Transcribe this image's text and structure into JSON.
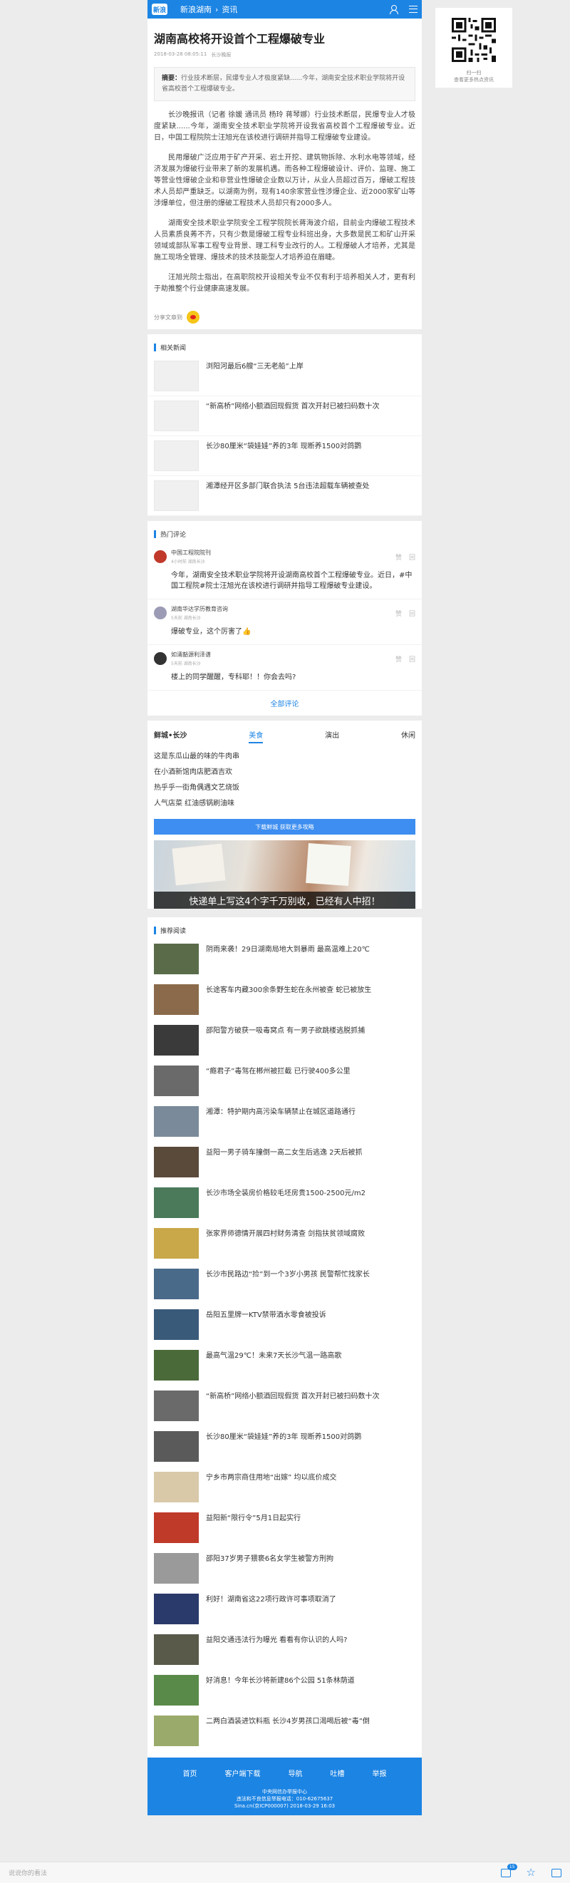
{
  "header": {
    "logo_text": "新浪",
    "breadcrumb": [
      "新浪湖南",
      "›",
      "资讯"
    ]
  },
  "article": {
    "title": "湖南高校将开设首个工程爆破专业",
    "date": "2018-03-28 08:05:11",
    "source": "长沙晚报",
    "summary_label": "摘要：",
    "summary": "行业技术断层，民爆专业人才极度紧缺......今年，湖南安全技术职业学院将开设省高校首个工程爆破专业。",
    "paragraphs": [
      "长沙晚报讯（记者 徐媛 通讯员 杨玲 蒋琴娜）行业技术断层，民爆专业人才极度紧缺......今年，湖南安全技术职业学院将开设我省高校首个工程爆破专业。近日，中国工程院院士汪旭光在该校进行调研并指导工程爆破专业建设。",
      "民用爆破广泛应用于矿产开采、岩土开挖、建筑物拆除、水利水电等领域，经济发展为爆破行业带来了新的发展机遇。而各种工程爆破设计、评价、监理、施工等营业性爆破企业和非营业性爆破企业数以万计，从业人员超过百万，爆破工程技术人员却严重缺乏。以湖南为例，现有140余家营业性涉爆企业、近2000家矿山等涉爆单位，但注册的爆破工程技术人员却只有2000多人。",
      "湖南安全技术职业学院安全工程学院院长蒋海波介绍，目前业内爆破工程技术人员素质良莠不齐，只有少数是爆破工程专业科班出身，大多数是民工和矿山开采领域或部队军事工程专业背景、理工科专业改行的人。工程爆破人才培养，尤其是施工现场全管理、爆技术的技术技能型人才培养迫在眉睫。",
      "汪旭光院士指出，在高职院校开设相关专业不仅有利于培养相关人才，更有利于助推整个行业健康高速发展。"
    ],
    "share_label": "分享文章到"
  },
  "related": {
    "heading": "相关新闻",
    "items": [
      "浏阳河最后6艘“三无老船”上岸",
      "“新高桥”网络小额酒回现假货 首次开封已被扫码数十次",
      "长沙80厘米“袋娃娃”养的3年 现断养1500对鸽鹦",
      "湘潭经开区多部门联合执法 5台违法超载车辆被查处"
    ]
  },
  "comments": {
    "heading": "热门评论",
    "items": [
      {
        "name": "中国工程院院刊",
        "time": "4小时前 湖南长沙",
        "text": "今年，湖南安全技术职业学院将开设湖南高校首个工程爆破专业。近日，#中国工程院#院士汪旭光在该校进行调研并指导工程爆破专业建设。",
        "avatar_color": "#c0392b"
      },
      {
        "name": "湖南华达学历教育咨询",
        "time": "5天前 湖南长沙",
        "text": "爆破专业，这个厉害了👍",
        "avatar_color": "#9b9bb5"
      },
      {
        "name": "如涌豁源利泽谱",
        "time": "5天前 湖南长沙",
        "text": "楼上的同学醒醒，专科耶！！你会去吗?",
        "avatar_color": "#333333"
      }
    ],
    "like_label": "赞",
    "reply_label": "回",
    "all_label": "全部评论"
  },
  "local": {
    "tabs": [
      "鲜城•长沙",
      "美食",
      "演出",
      "休闲"
    ],
    "active_tab": "美食",
    "items": [
      "这是东瓜山最的味的牛肉串",
      "在小酒新馆肉店肥酒吉欢",
      "热乎乎一街角偶遇文艺烧饭",
      "人气店菜 红油感锅刷油味"
    ],
    "download_label": "下载鲜城 获取更多攻略",
    "ad_caption": "快递单上写这4个字千万别收，已经有人中招！"
  },
  "recommend": {
    "heading": "推荐阅读",
    "items": [
      {
        "title": "阴雨来袭！29日湖南局地大到暴雨 最高温难上20℃",
        "color": "#5a6b4a"
      },
      {
        "title": "长途客车内藏300余条野生蛇在永州被查 蛇已被放生",
        "color": "#8a6a4a"
      },
      {
        "title": "邵阳警方破获一吸毒窝点 有一男子欲跳楼逃脱抓捕",
        "color": "#3a3a3a"
      },
      {
        "title": "“瘾君子”毒驾在郴州被拦截 已行驶400多公里",
        "color": "#6a6a6a"
      },
      {
        "title": "湘潭：特护期内高污染车辆禁止在城区道路通行",
        "color": "#7a8a9a"
      },
      {
        "title": "益阳一男子骑车撞倒一高二女生后逃逸 2天后被抓",
        "color": "#5a4a3a"
      },
      {
        "title": "长沙市场全装房价格较毛坯房贵1500-2500元/m2",
        "color": "#4a7a5a"
      },
      {
        "title": "张家界师德情开展四村财务清查 剑指扶贫领域腐败",
        "color": "#c9a84a"
      },
      {
        "title": "长沙市民路边“捡”到一个3岁小男孩 民警帮忙找家长",
        "color": "#4a6a8a"
      },
      {
        "title": "岳阳五里牌一KTV禁带酒水零食被投诉",
        "color": "#3a5a7a"
      },
      {
        "title": "最高气温29℃！未来7天长沙气温一路高歌",
        "color": "#4a6a3a"
      },
      {
        "title": "“新高桥”网络小额酒回现假货 首次开封已被扫码数十次",
        "color": "#6a6a6a"
      },
      {
        "title": "长沙80厘米“袋娃娃”养的3年 现断养1500对鸽鹦",
        "color": "#5a5a5a"
      },
      {
        "title": "宁乡市两宗商住用地“出嫁” 均以底价成交",
        "color": "#d9c9a9"
      },
      {
        "title": "益阳新“限行令”5月1日起实行",
        "color": "#c03a2a"
      },
      {
        "title": "邵阳37岁男子猥亵6名女学生被警方刑拘",
        "color": "#9a9a9a"
      },
      {
        "title": "利好！湖南省这22项行政许可事项取消了",
        "color": "#2a3a6a"
      },
      {
        "title": "益阳交通违法行为曝光 看看有你认识的人吗?",
        "color": "#5a5a4a"
      },
      {
        "title": "好消息！今年长沙将新建86个公园 51条林荫道",
        "color": "#5a8a4a"
      },
      {
        "title": "二两白酒装进饮料瓶 长沙4岁男孩口渴喝后被“毒”倒",
        "color": "#9aaa6a"
      }
    ]
  },
  "footer": {
    "nav": [
      "首页",
      "客户端下载",
      "导航",
      "吐槽",
      "举报"
    ],
    "info": [
      "中央网信办举报中心",
      "违法和不良信息举报电话：010-62675637",
      "Sina.cn(京ICP000007) 2018-03-29 16:03"
    ]
  },
  "qr": {
    "caption_line1": "扫一扫",
    "caption_line2": "查看更多热点资讯"
  },
  "bottombar": {
    "input_placeholder": "说说你的看法",
    "comment_count": "15"
  }
}
